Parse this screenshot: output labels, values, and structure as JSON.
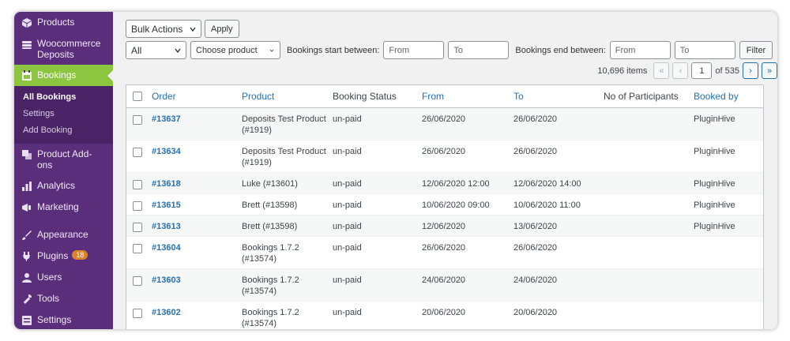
{
  "sidebar": {
    "items_top": [
      {
        "label": "Products",
        "icon": "products-icon"
      },
      {
        "label": "Woocommerce Deposits",
        "icon": "deposits-icon"
      }
    ],
    "active": {
      "label": "Bookings",
      "icon": "calendar-icon"
    },
    "submenu": [
      {
        "label": "All Bookings",
        "current": true
      },
      {
        "label": "Settings",
        "current": false
      },
      {
        "label": "Add Booking",
        "current": false
      }
    ],
    "items_mid": [
      {
        "label": "Product Add-ons",
        "icon": "addons-icon"
      },
      {
        "label": "Analytics",
        "icon": "analytics-icon"
      },
      {
        "label": "Marketing",
        "icon": "megaphone-icon"
      }
    ],
    "items_bottom": [
      {
        "label": "Appearance",
        "icon": "brush-icon"
      },
      {
        "label": "Plugins",
        "icon": "plug-icon",
        "badge": "18"
      },
      {
        "label": "Users",
        "icon": "user-icon"
      },
      {
        "label": "Tools",
        "icon": "wrench-icon"
      },
      {
        "label": "Settings",
        "icon": "settings-icon"
      }
    ],
    "colors": {
      "bg": "#5a2e7b",
      "active": "#8cc540",
      "badge": "#d9822b"
    }
  },
  "toolbar": {
    "bulk_actions": "Bulk Actions",
    "apply": "Apply",
    "filter_all": "All",
    "choose_product": "Choose product",
    "start_label": "Bookings start between:",
    "end_label": "Bookings end between:",
    "from_placeholder": "From",
    "to_placeholder": "To",
    "filter": "Filter"
  },
  "pagination": {
    "items": "10,696 items",
    "first": "«",
    "prev": "‹",
    "current": "1",
    "of": "of 535",
    "next": "›",
    "last": "»"
  },
  "table": {
    "headers": {
      "order": "Order",
      "product": "Product",
      "status": "Booking Status",
      "from": "From",
      "to": "To",
      "participants": "No of Participants",
      "booked_by": "Booked by"
    },
    "rows": [
      {
        "order": "#13637",
        "product": "Deposits Test Product (#1919)",
        "status": "un-paid",
        "from": "26/06/2020",
        "to": "26/06/2020",
        "participants": "",
        "booked_by": "PluginHive"
      },
      {
        "order": "#13634",
        "product": "Deposits Test Product (#1919)",
        "status": "un-paid",
        "from": "26/06/2020",
        "to": "26/06/2020",
        "participants": "",
        "booked_by": "PluginHive"
      },
      {
        "order": "#13618",
        "product": "Luke (#13601)",
        "status": "un-paid",
        "from": "12/06/2020 12:00",
        "to": "12/06/2020 14:00",
        "participants": "",
        "booked_by": "PluginHive"
      },
      {
        "order": "#13615",
        "product": "Brett (#13598)",
        "status": "un-paid",
        "from": "10/06/2020 09:00",
        "to": "10/06/2020 11:00",
        "participants": "",
        "booked_by": "PluginHive"
      },
      {
        "order": "#13613",
        "product": "Brett (#13598)",
        "status": "un-paid",
        "from": "12/06/2020",
        "to": "13/06/2020",
        "participants": "",
        "booked_by": "PluginHive"
      },
      {
        "order": "#13604",
        "product": "Bookings 1.7.2 (#13574)",
        "status": "un-paid",
        "from": "26/06/2020",
        "to": "26/06/2020",
        "participants": "",
        "booked_by": ""
      },
      {
        "order": "#13603",
        "product": "Bookings 1.7.2 (#13574)",
        "status": "un-paid",
        "from": "24/06/2020",
        "to": "24/06/2020",
        "participants": "",
        "booked_by": ""
      },
      {
        "order": "#13602",
        "product": "Bookings 1.7.2 (#13574)",
        "status": "un-paid",
        "from": "20/06/2020",
        "to": "20/06/2020",
        "participants": "",
        "booked_by": ""
      }
    ]
  }
}
